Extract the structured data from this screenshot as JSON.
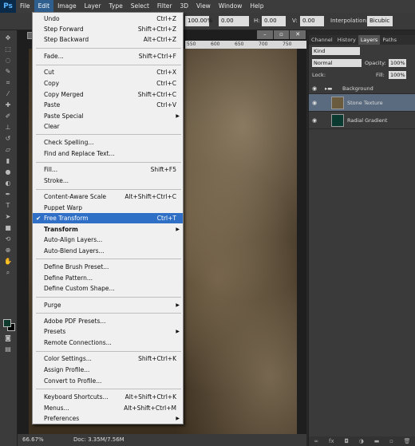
{
  "app": {
    "logo": "Ps"
  },
  "menubar": [
    "File",
    "Edit",
    "Image",
    "Layer",
    "Type",
    "Select",
    "Filter",
    "3D",
    "View",
    "Window",
    "Help"
  ],
  "options": {
    "zoom": "100.00%",
    "angle": "0.00",
    "h": "0.00",
    "v": "0.00",
    "h_label": "H:",
    "v_label": "V:",
    "interp_label": "Interpolation:",
    "interp_value": "Bicubic"
  },
  "ruler": [
    "550",
    "600",
    "650",
    "700",
    "750"
  ],
  "menu": {
    "undo": {
      "label": "Undo",
      "shortcut": "Ctrl+Z"
    },
    "step_forward": {
      "label": "Step Forward",
      "shortcut": "Shift+Ctrl+Z"
    },
    "step_backward": {
      "label": "Step Backward",
      "shortcut": "Alt+Ctrl+Z"
    },
    "fade": {
      "label": "Fade...",
      "shortcut": "Shift+Ctrl+F"
    },
    "cut": {
      "label": "Cut",
      "shortcut": "Ctrl+X"
    },
    "copy": {
      "label": "Copy",
      "shortcut": "Ctrl+C"
    },
    "copy_merged": {
      "label": "Copy Merged",
      "shortcut": "Shift+Ctrl+C"
    },
    "paste": {
      "label": "Paste",
      "shortcut": "Ctrl+V"
    },
    "paste_special": {
      "label": "Paste Special"
    },
    "clear": {
      "label": "Clear"
    },
    "check_spelling": {
      "label": "Check Spelling..."
    },
    "find_replace": {
      "label": "Find and Replace Text..."
    },
    "fill": {
      "label": "Fill...",
      "shortcut": "Shift+F5"
    },
    "stroke": {
      "label": "Stroke..."
    },
    "content_aware_scale": {
      "label": "Content-Aware Scale",
      "shortcut": "Alt+Shift+Ctrl+C"
    },
    "puppet_warp": {
      "label": "Puppet Warp"
    },
    "free_transform": {
      "label": "Free Transform",
      "shortcut": "Ctrl+T"
    },
    "transform": {
      "label": "Transform"
    },
    "auto_align": {
      "label": "Auto-Align Layers..."
    },
    "auto_blend": {
      "label": "Auto-Blend Layers..."
    },
    "define_brush": {
      "label": "Define Brush Preset..."
    },
    "define_pattern": {
      "label": "Define Pattern..."
    },
    "define_shape": {
      "label": "Define Custom Shape..."
    },
    "purge": {
      "label": "Purge"
    },
    "pdf_presets": {
      "label": "Adobe PDF Presets..."
    },
    "presets": {
      "label": "Presets"
    },
    "remote_connections": {
      "label": "Remote Connections..."
    },
    "color_settings": {
      "label": "Color Settings...",
      "shortcut": "Shift+Ctrl+K"
    },
    "assign_profile": {
      "label": "Assign Profile..."
    },
    "convert_profile": {
      "label": "Convert to Profile..."
    },
    "keyboard_shortcuts": {
      "label": "Keyboard Shortcuts...",
      "shortcut": "Alt+Shift+Ctrl+K"
    },
    "menus": {
      "label": "Menus...",
      "shortcut": "Alt+Shift+Ctrl+M"
    },
    "preferences": {
      "label": "Preferences"
    }
  },
  "status": {
    "zoom": "66.67%",
    "doc": "Doc: 3.35M/7.56M"
  },
  "panel": {
    "tabs": [
      "Channel",
      "History",
      "Layers",
      "Paths"
    ],
    "kind": "Kind",
    "blend_mode": "Normal",
    "opacity_label": "Opacity:",
    "opacity": "100%",
    "lock_label": "Lock:",
    "fill_label": "Fill:",
    "fill": "100%",
    "group_name": "Background",
    "layers": [
      "Stone Texture",
      "Radial Gradient"
    ]
  }
}
